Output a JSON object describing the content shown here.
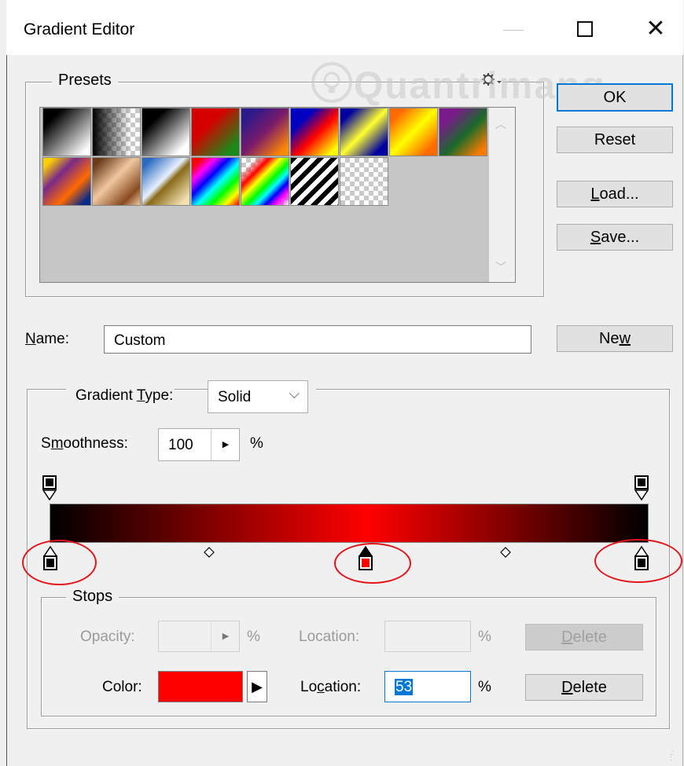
{
  "window": {
    "title": "Gradient Editor",
    "controls": {
      "minimize": "—",
      "maximize": "□",
      "close": "✕"
    }
  },
  "watermark": {
    "text": "Quantrimang"
  },
  "presets": {
    "label": "Presets",
    "gear_icon": "gear-icon",
    "swatches": [
      {
        "name": "black-white"
      },
      {
        "name": "transparent-fade"
      },
      {
        "name": "black-to-white"
      },
      {
        "name": "red-green"
      },
      {
        "name": "violet-orange"
      },
      {
        "name": "blue-red-yellow"
      },
      {
        "name": "blue-yellow-blue"
      },
      {
        "name": "orange-yellow-orange"
      },
      {
        "name": "violet-green-orange"
      },
      {
        "name": "yellow-violet-orange-blue"
      },
      {
        "name": "copper"
      },
      {
        "name": "chrome"
      },
      {
        "name": "spectrum"
      },
      {
        "name": "transparent-rainbow"
      },
      {
        "name": "transparent-stripes"
      },
      {
        "name": "transparent-checker"
      }
    ]
  },
  "buttons": {
    "ok": "OK",
    "reset": "Reset",
    "load_pre": "",
    "load_u": "L",
    "load_post": "oad...",
    "save_u": "S",
    "save_post": "ave...",
    "new_pre": "Ne",
    "new_u": "w"
  },
  "name_field": {
    "label_u": "N",
    "label_post": "ame:",
    "value": "Custom"
  },
  "gradient": {
    "type_label_pre": "Gradient ",
    "type_label_u": "T",
    "type_label_post": "ype:",
    "type_value": "Solid",
    "smoothness_label_pre": "S",
    "smoothness_label_u": "m",
    "smoothness_label_post": "oothness:",
    "smoothness_value": "100",
    "percent": "%",
    "colors": {
      "start": "#000000",
      "mid": "#ff0000",
      "end": "#000000"
    },
    "color_stop_location": 53
  },
  "stops": {
    "label": "Stops",
    "opacity_label": "Opacity:",
    "opacity_value": "",
    "percent": "%",
    "location_label": "Location:",
    "location_opacity_value": "",
    "delete_pre": "",
    "delete_u": "D",
    "delete_post": "elete",
    "color_label": "Color:",
    "color_value": "#ff0000",
    "color_location_label_pre": "Lo",
    "color_location_label_u": "c",
    "color_location_label_post": "ation:",
    "color_location_value": "53"
  }
}
